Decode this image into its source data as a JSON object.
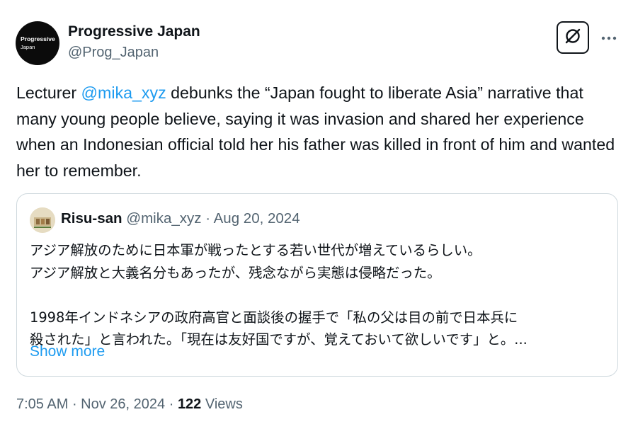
{
  "author": {
    "avatar_text_line1": "Progressive",
    "avatar_text_line2": "Japan",
    "name": "Progressive Japan",
    "handle": "@Prog_Japan"
  },
  "icons": {
    "grok": "grok-icon",
    "more": "more-icon"
  },
  "tweet": {
    "text_before": "Lecturer ",
    "mention": "@mika_xyz",
    "text_after": " debunks the “Japan fought to liberate Asia” narrative that many young people believe, saying it was invasion and shared her experience when an Indonesian official told her his father was killed in front of him and wanted her to remember."
  },
  "quote": {
    "name": "Risu-san",
    "handle": "@mika_xyz",
    "separator": " · ",
    "date": "Aug 20, 2024",
    "lines": [
      "アジア解放のために日本軍が戦ったとする若い世代が増えているらしい。",
      "アジア解放と大義名分もあったが、残念ながら実態は侵略だった。",
      "",
      "1998年インドネシアの政府高官と面談後の握手で「私の父は目の前で日本兵に",
      "殺された」と言われた。「現在は友好国ですが、覚えておいて欲しいです」と。..."
    ],
    "show_more": "Show more"
  },
  "footer": {
    "time": "7:05 AM",
    "date": "Nov 26, 2024",
    "separator": " · ",
    "views_count": "122",
    "views_label": " Views"
  },
  "colors": {
    "text": "#0f1419",
    "secondary": "#536471",
    "link": "#1d9bf0",
    "border": "#cfd9de"
  }
}
